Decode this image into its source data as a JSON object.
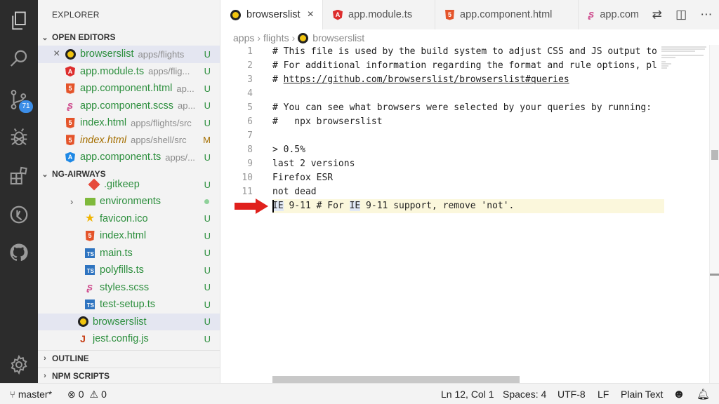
{
  "activity": {
    "scm_badge": "71"
  },
  "sidebar": {
    "title": "EXPLORER",
    "open_editors_label": "OPEN EDITORS",
    "open_editors": [
      {
        "name": "browserslist",
        "path": "apps/flights",
        "status": "U",
        "icon": "browserslist-icon"
      },
      {
        "name": "app.module.ts",
        "path": "apps/flig...",
        "status": "U",
        "icon": "angular-icon"
      },
      {
        "name": "app.component.html",
        "path": "ap...",
        "status": "U",
        "icon": "html-icon"
      },
      {
        "name": "app.component.scss",
        "path": "ap...",
        "status": "U",
        "icon": "sass-icon"
      },
      {
        "name": "index.html",
        "path": "apps/flights/src",
        "status": "U",
        "icon": "html-icon"
      },
      {
        "name": "index.html",
        "path": "apps/shell/src",
        "status": "M",
        "icon": "html-icon"
      },
      {
        "name": "app.component.ts",
        "path": "apps/...",
        "status": "U",
        "icon": "angular-ts-icon"
      }
    ],
    "workspace_label": "NG-AIRWAYS",
    "files": [
      {
        "name": ".gitkeep",
        "status": "U"
      },
      {
        "name": "environments",
        "status": ""
      },
      {
        "name": "favicon.ico",
        "status": "U"
      },
      {
        "name": "index.html",
        "status": "U"
      },
      {
        "name": "main.ts",
        "status": "U"
      },
      {
        "name": "polyfills.ts",
        "status": "U"
      },
      {
        "name": "styles.scss",
        "status": "U"
      },
      {
        "name": "test-setup.ts",
        "status": "U"
      },
      {
        "name": "browserslist",
        "status": "U"
      },
      {
        "name": "jest.config.js",
        "status": "U"
      }
    ],
    "outline_label": "OUTLINE",
    "npm_label": "NPM SCRIPTS"
  },
  "tabs": [
    {
      "label": "browserslist",
      "active": true
    },
    {
      "label": "app.module.ts"
    },
    {
      "label": "app.component.html"
    },
    {
      "label": "app.com"
    }
  ],
  "breadcrumb": [
    "apps",
    "flights",
    "browserslist"
  ],
  "editor": {
    "line_numbers": [
      "1",
      "2",
      "3",
      "4",
      "5",
      "6",
      "7",
      "8",
      "9",
      "10",
      "11",
      ""
    ],
    "lines": [
      "# This file is used by the build system to adjust CSS and JS output to",
      "# For additional information regarding the format and rule options, pl",
      "# https://github.com/browserslist/browserslist#queries",
      "",
      "# You can see what browsers were selected by your queries by running:",
      "#   npx browserslist",
      "",
      "> 0.5%",
      "last 2 versions",
      "Firefox ESR",
      "not dead"
    ],
    "current_line": {
      "p1": "IE",
      "p2": " 9-11 # For ",
      "p3": "IE",
      "p4": " 9-11 support, remove 'not'."
    }
  },
  "status": {
    "branch": "master*",
    "errors": "0",
    "warnings": "0",
    "position": "Ln 12, Col 1",
    "spaces": "Spaces: 4",
    "encoding": "UTF-8",
    "eol": "LF",
    "language": "Plain Text"
  },
  "colors": {
    "activity_bg": "#2c2c2c",
    "untracked": "#2d8f3e",
    "modified": "#a56f00",
    "highlight_line": "#fbf7dc",
    "arrow": "#e0201c"
  }
}
